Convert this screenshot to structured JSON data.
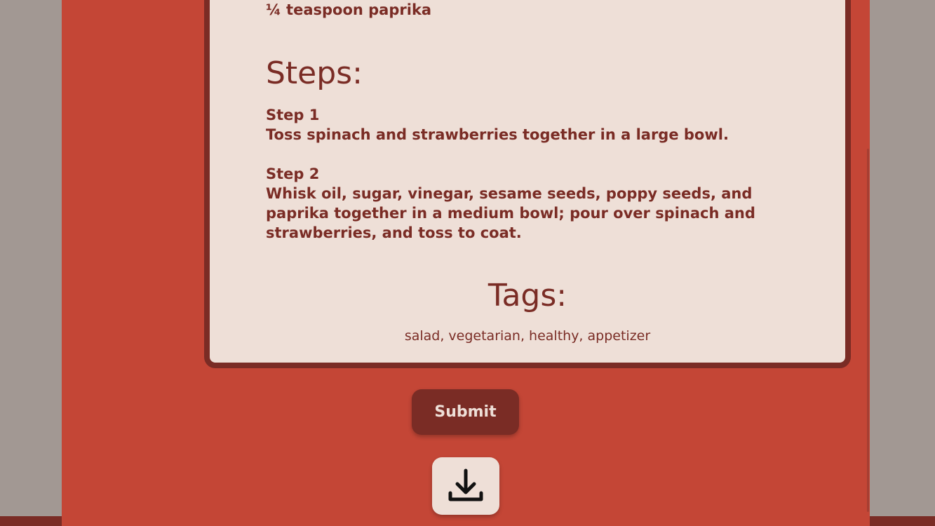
{
  "recipe": {
    "last_ingredient": "¼ teaspoon paprika",
    "steps_heading": "Steps:",
    "steps": [
      {
        "title": "Step 1",
        "text": "Toss spinach and strawberries together in a large bowl."
      },
      {
        "title": "Step 2",
        "text": "Whisk oil, sugar, vinegar, sesame seeds, poppy seeds, and paprika together in a medium bowl; pour over spinach and strawberries, and toss to coat."
      }
    ],
    "tags_heading": "Tags:",
    "tags": "salad, vegetarian, healthy, appetizer"
  },
  "actions": {
    "submit_label": "Submit",
    "download_icon": "download-icon"
  },
  "colors": {
    "page_background": "#a29893",
    "panel_background": "#c44636",
    "card_background": "#eedfd7",
    "accent": "#7a2c25"
  }
}
